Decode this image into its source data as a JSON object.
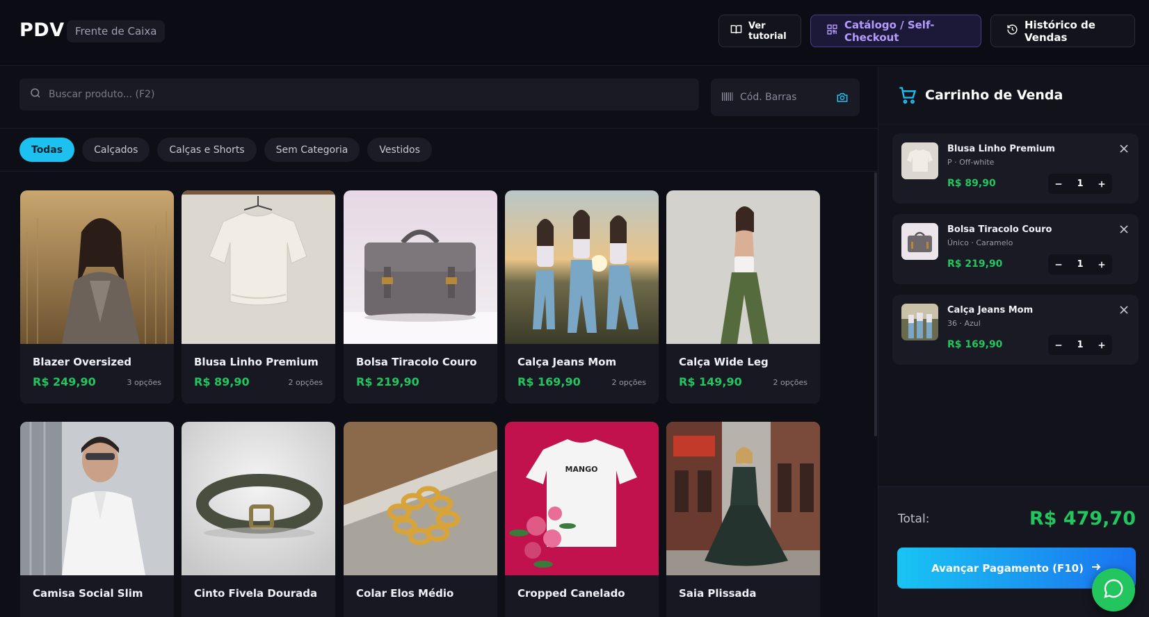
{
  "header": {
    "logo": "PDV",
    "mode": "Frente de Caixa",
    "tutorial_label": "Ver tutorial",
    "catalog_label": "Catálogo / Self-Checkout",
    "history_label": "Histórico de Vendas"
  },
  "search": {
    "placeholder": "Buscar produto... (F2)",
    "barcode_placeholder": "Cód. Barras"
  },
  "filters": [
    "Todas",
    "Calçados",
    "Calças e Shorts",
    "Sem Categoria",
    "Vestidos"
  ],
  "products": [
    {
      "name": "Blazer Oversized",
      "price": "R$ 249,90",
      "options": "3 opções"
    },
    {
      "name": "Blusa Linho Premium",
      "price": "R$ 89,90",
      "options": "2 opções"
    },
    {
      "name": "Bolsa Tiracolo Couro",
      "price": "R$ 219,90",
      "options": ""
    },
    {
      "name": "Calça Jeans Mom",
      "price": "R$ 169,90",
      "options": "2 opções"
    },
    {
      "name": "Calça Wide Leg",
      "price": "R$ 149,90",
      "options": "2 opções"
    },
    {
      "name": "Camisa Social Slim",
      "price": "",
      "options": ""
    },
    {
      "name": "Cinto Fivela Dourada",
      "price": "",
      "options": ""
    },
    {
      "name": "Colar Elos Médio",
      "price": "",
      "options": ""
    },
    {
      "name": "Cropped Canelado",
      "price": "",
      "options": ""
    },
    {
      "name": "Saia Plissada",
      "price": "",
      "options": ""
    }
  ],
  "cart": {
    "title": "Carrinho de Venda",
    "items": [
      {
        "name": "Blusa Linho Premium",
        "variant": "P · Off-white",
        "price": "R$ 89,90",
        "qty": "1"
      },
      {
        "name": "Bolsa Tiracolo Couro",
        "variant": "Único · Caramelo",
        "price": "R$ 219,90",
        "qty": "1"
      },
      {
        "name": "Calça Jeans Mom",
        "variant": "36 · Azul",
        "price": "R$ 169,90",
        "qty": "1"
      }
    ],
    "total_label": "Total:",
    "total_value": "R$ 479,70",
    "pay_label": "Avançar Pagamento (F10)"
  },
  "colors": {
    "accent": "#1cc1f0",
    "price": "#22c55e",
    "catalog": "#b49cff",
    "background": "#0c0c14"
  },
  "icons": {
    "tutorial": "book-icon",
    "catalog": "qr-code-icon",
    "history": "history-icon",
    "search": "search-icon",
    "barcode": "barcode-icon",
    "camera": "camera-icon",
    "cart": "cart-icon",
    "remove": "close-icon",
    "pay": "arrow-right-icon",
    "chat": "chat-icon"
  }
}
